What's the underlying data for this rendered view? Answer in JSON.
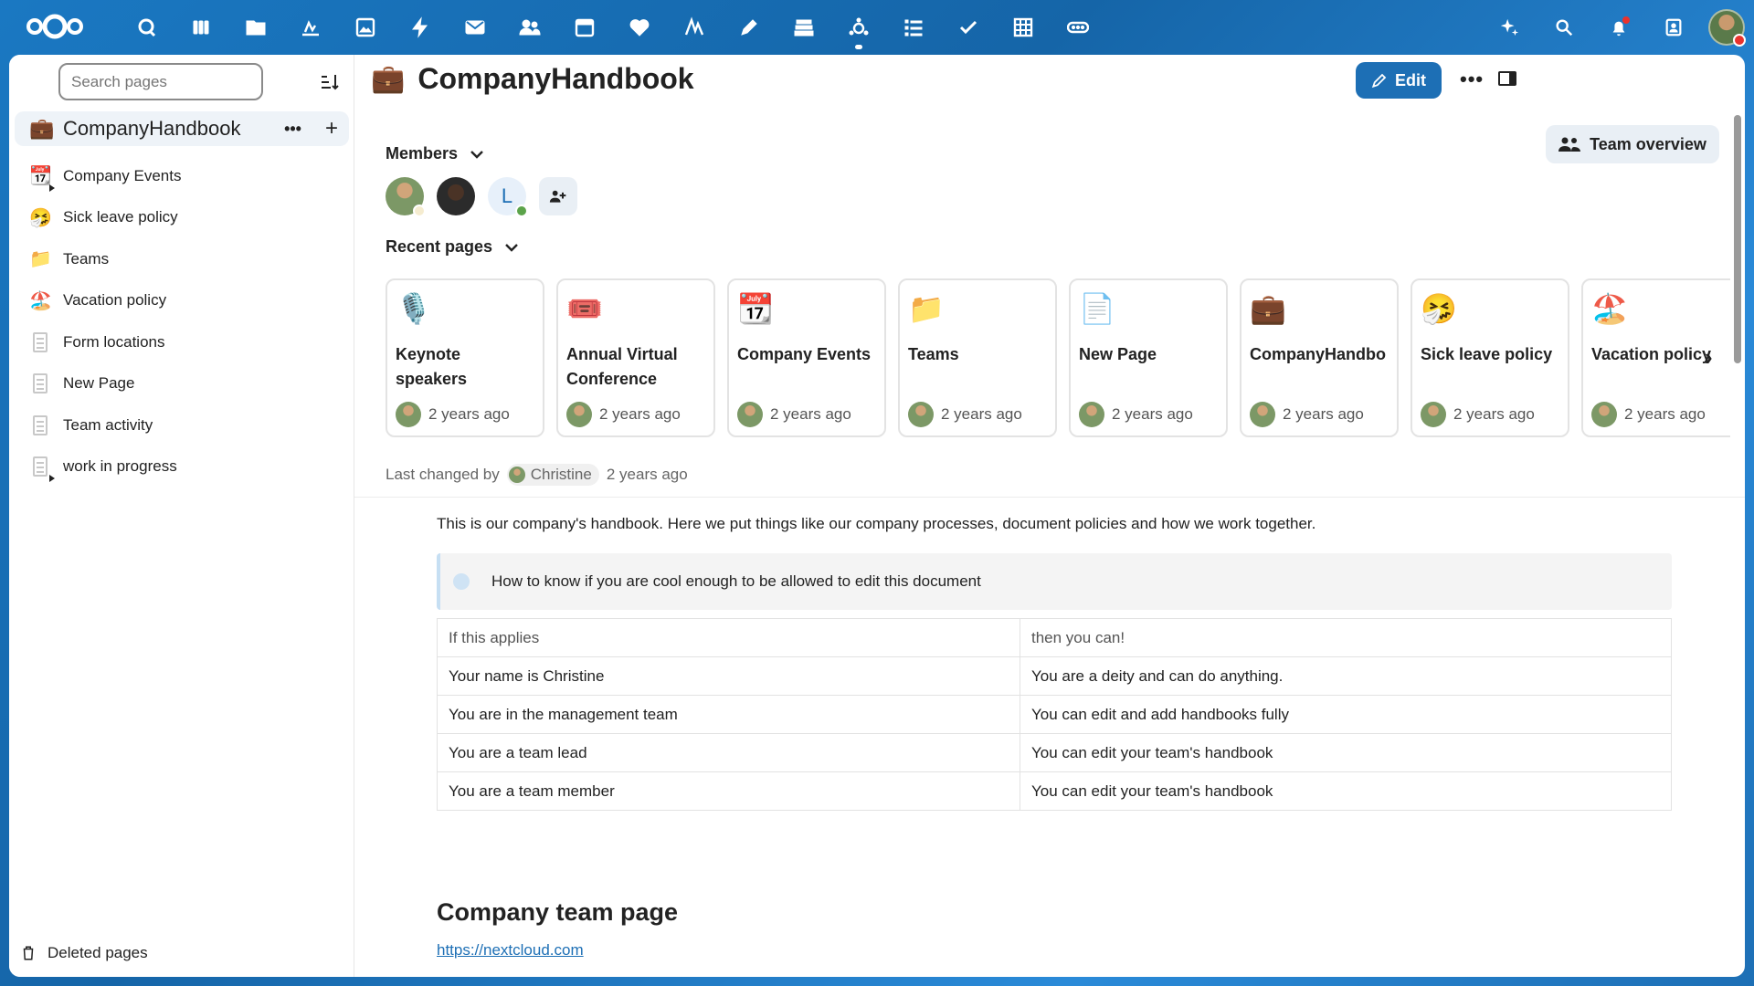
{
  "topbar": {
    "apps": [
      "dashboard-icon",
      "deck-icon",
      "files-icon",
      "activity-icon",
      "photos-icon",
      "flash-icon",
      "mail-icon",
      "contacts-icon",
      "calendar-icon",
      "health-icon",
      "text-icon",
      "notes-icon",
      "stack-icon",
      "collectives-icon",
      "tasks-icon",
      "checkmark-icon",
      "tables-icon",
      "ocs-icon"
    ],
    "active_app": "collectives-icon",
    "right_icons": [
      "assistant-icon",
      "search-icon",
      "notifications-icon",
      "contacts-menu-icon"
    ]
  },
  "sidebar": {
    "search_placeholder": "Search pages",
    "root": {
      "emoji": "💼",
      "label": "CompanyHandbook"
    },
    "items": [
      {
        "emoji": "📆",
        "label": "Company Events",
        "has_children": true
      },
      {
        "emoji": "🤧",
        "label": "Sick leave policy"
      },
      {
        "emoji": "📁",
        "label": "Teams"
      },
      {
        "emoji": "🏖️",
        "label": "Vacation policy"
      },
      {
        "emoji": "",
        "label": "Form locations"
      },
      {
        "emoji": "",
        "label": "New Page"
      },
      {
        "emoji": "",
        "label": "Team activity"
      },
      {
        "emoji": "",
        "label": "work in progress",
        "has_children": true
      }
    ],
    "deleted_label": "Deleted pages"
  },
  "page": {
    "emoji": "💼",
    "title": "CompanyHandbook",
    "edit_label": "Edit",
    "team_overview_label": "Team overview",
    "members_label": "Members",
    "member_initial": "L",
    "recent_label": "Recent pages",
    "recent_pages": [
      {
        "emoji": "🎙️",
        "title": "Keynote speakers",
        "time": "2 years ago"
      },
      {
        "emoji": "🎟️",
        "title": "Annual Virtual Conference",
        "time": "2 years ago"
      },
      {
        "emoji": "📆",
        "title": "Company Events",
        "time": "2 years ago"
      },
      {
        "emoji": "📁",
        "title": "Teams",
        "time": "2 years ago"
      },
      {
        "emoji": "📄",
        "title": "New Page",
        "time": "2 years ago"
      },
      {
        "emoji": "💼",
        "title": "CompanyHandbo",
        "time": "2 years ago"
      },
      {
        "emoji": "🤧",
        "title": "Sick leave policy",
        "time": "2 years ago"
      },
      {
        "emoji": "🏖️",
        "title": "Vacation policy",
        "time": "2 years ago"
      }
    ],
    "last_changed_prefix": "Last changed by",
    "last_changed_user": "Christine",
    "last_changed_time": "2 years ago",
    "intro": "This is our company's handbook. Here we put things like our company processes, document policies and how we work together.",
    "callout": "How to know if you are cool enough to be allowed to edit this document",
    "table": {
      "headers": [
        "If this applies",
        "then you can!"
      ],
      "rows": [
        [
          "Your name is Christine",
          "You are a deity and can do anything."
        ],
        [
          "You are in the management team",
          "You can edit and add handbooks fully"
        ],
        [
          "You are a team lead",
          "You can edit your team's handbook"
        ],
        [
          "You are a team member",
          "You can edit your team's handbook"
        ]
      ]
    },
    "heading2": "Company team page",
    "link": "https://nextcloud.com"
  },
  "colors": {
    "brand": "#1d6fb5",
    "danger": "#e9322d"
  }
}
